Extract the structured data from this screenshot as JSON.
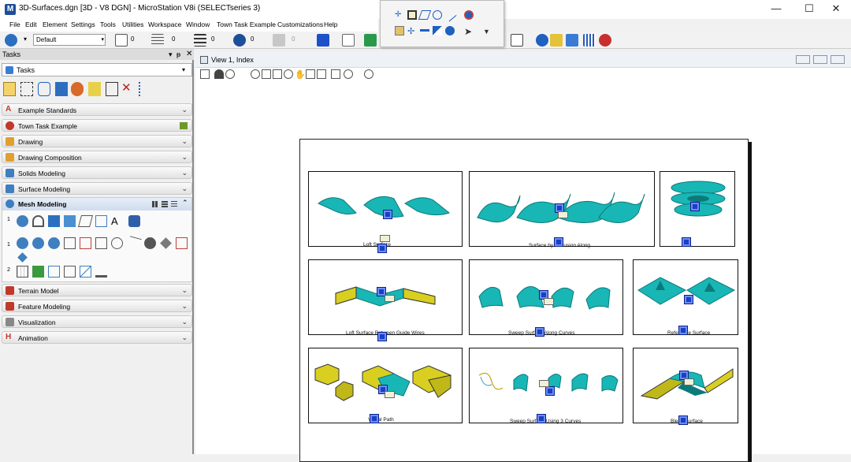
{
  "window": {
    "title": "3D-Surfaces.dgn [3D - V8 DGN] - MicroStation V8i (SELECTseries 3)",
    "app_icon": "M",
    "controls": {
      "minimize": "—",
      "maximize": "☐",
      "close": "✕"
    }
  },
  "menu": [
    "File",
    "Edit",
    "Element",
    "Settings",
    "Tools",
    "Utilities",
    "Workspace",
    "Window",
    "Town Task Example",
    "Customizations",
    "Help"
  ],
  "toolbar": {
    "level_combo": "Default",
    "weight_values": [
      "0",
      "0",
      "0",
      "0",
      "0"
    ]
  },
  "tasks": {
    "header": "Tasks",
    "header_controls": {
      "dropdown": "▾",
      "pin": "ᵽ",
      "close": "✕"
    },
    "combo_value": "Tasks",
    "sections": [
      {
        "label": "Example Standards",
        "icon": "a-icon",
        "color": "#c0392b"
      },
      {
        "label": "Town Task Example",
        "icon": "town-icon",
        "color": "#c0392b"
      },
      {
        "label": "Drawing",
        "icon": "drawing-icon",
        "color": "#e0a030"
      },
      {
        "label": "Drawing Composition",
        "icon": "composition-icon",
        "color": "#e0a030"
      },
      {
        "label": "Solids Modeling",
        "icon": "solids-icon",
        "color": "#3f7fbf"
      },
      {
        "label": "Surface Modeling",
        "icon": "surface-icon",
        "color": "#3f7fbf"
      }
    ],
    "active_section": {
      "label": "Mesh Modeling",
      "side_labels": [
        "1",
        "1",
        "2"
      ]
    },
    "sections_after": [
      {
        "label": "Terrain Model",
        "icon": "terrain-icon",
        "color": "#c0392b"
      },
      {
        "label": "Feature Modeling",
        "icon": "feature-icon",
        "color": "#c0392b"
      },
      {
        "label": "Visualization",
        "icon": "visualization-icon",
        "color": "#888888"
      },
      {
        "label": "Animation",
        "icon": "animation-icon",
        "color": "#c0392b"
      }
    ]
  },
  "view": {
    "title": "View 1, Index",
    "captions": [
      "Loft Surface",
      "Surface by Extrusion Along",
      "",
      "Loft Surface Between Guide Wires",
      "Sweep Surface Along Curves",
      "Reference Surface",
      "Visual Path",
      "Sweep Surface Using 3 Curves",
      "Blend Surface"
    ]
  },
  "colors": {
    "surface_cyan": "#19b6b6",
    "surface_dark": "#0d7a7a",
    "handle_blue": "#1a3ec8",
    "solid_yellow": "#d8cf20"
  }
}
